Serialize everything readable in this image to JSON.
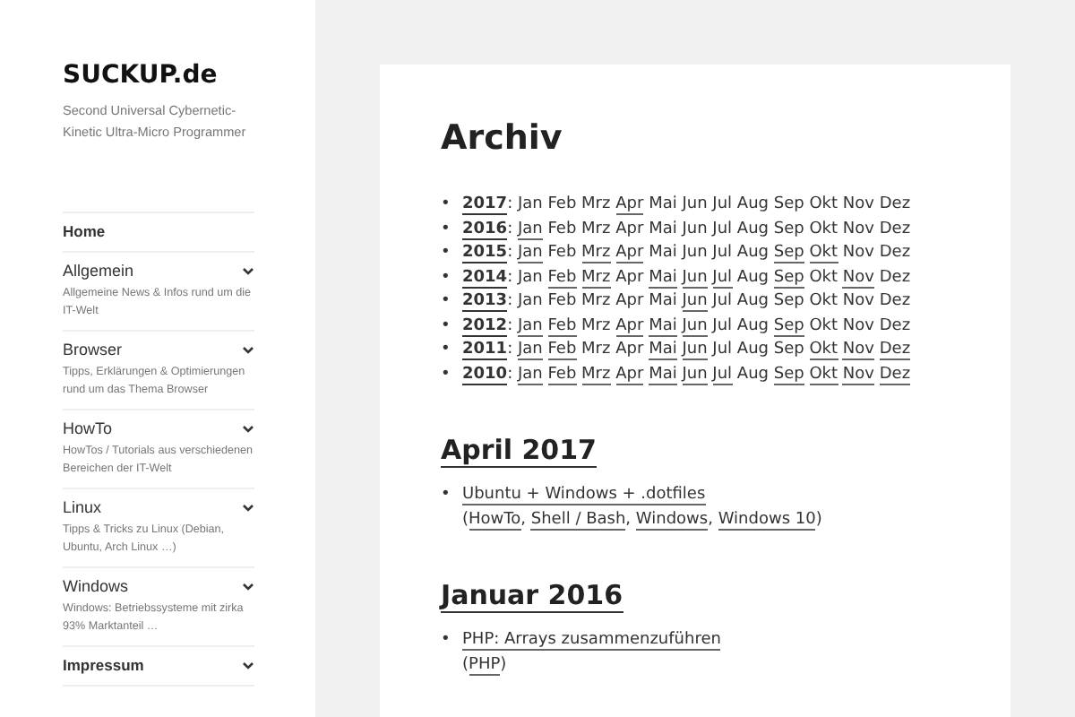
{
  "site": {
    "title": "SUCKUP.de",
    "tagline": "Second Universal Cybernetic-Kinetic Ultra-Micro Programmer"
  },
  "nav": [
    {
      "label": "Home",
      "bold": true,
      "has_submenu": false
    },
    {
      "label": "Allgemein",
      "description": "Allgemeine News & Infos rund um die IT-Welt",
      "bold": false,
      "has_submenu": true
    },
    {
      "label": "Browser",
      "description": "Tipps, Erklärungen & Optimierungen rund um das Thema Browser",
      "bold": false,
      "has_submenu": true
    },
    {
      "label": "HowTo",
      "description": "HowTos / Tutorials aus verschiedenen Bereichen der IT-Welt",
      "bold": false,
      "has_submenu": true
    },
    {
      "label": "Linux",
      "description": "Tipps & Tricks zu Linux (Debian, Ubuntu, Arch Linux …)",
      "bold": false,
      "has_submenu": true
    },
    {
      "label": "Windows",
      "description": "Windows: Betriebssysteme mit zirka 93% Marktanteil …",
      "bold": false,
      "has_submenu": true
    },
    {
      "label": "Impressum",
      "bold": true,
      "has_submenu": true
    }
  ],
  "archive": {
    "title": "Archiv",
    "years": [
      {
        "bullet": "•",
        "year": "2017",
        "separator": ":",
        "months": [
          {
            "label": "Jan",
            "linked": false
          },
          {
            "label": "Feb",
            "linked": false
          },
          {
            "label": "Mrz",
            "linked": false
          },
          {
            "label": "Apr",
            "linked": true
          },
          {
            "label": "Mai",
            "linked": false
          },
          {
            "label": "Jun",
            "linked": false
          },
          {
            "label": "Jul",
            "linked": false
          },
          {
            "label": "Aug",
            "linked": false
          },
          {
            "label": "Sep",
            "linked": false
          },
          {
            "label": "Okt",
            "linked": false
          },
          {
            "label": "Nov",
            "linked": false
          },
          {
            "label": "Dez",
            "linked": false
          }
        ]
      },
      {
        "bullet": "•",
        "year": "2016",
        "separator": ":",
        "months": [
          {
            "label": "Jan",
            "linked": true
          },
          {
            "label": "Feb",
            "linked": false
          },
          {
            "label": "Mrz",
            "linked": false
          },
          {
            "label": "Apr",
            "linked": false
          },
          {
            "label": "Mai",
            "linked": false
          },
          {
            "label": "Jun",
            "linked": false
          },
          {
            "label": "Jul",
            "linked": false
          },
          {
            "label": "Aug",
            "linked": false
          },
          {
            "label": "Sep",
            "linked": false
          },
          {
            "label": "Okt",
            "linked": false
          },
          {
            "label": "Nov",
            "linked": false
          },
          {
            "label": "Dez",
            "linked": false
          }
        ]
      },
      {
        "bullet": "•",
        "year": "2015",
        "separator": ":",
        "months": [
          {
            "label": "Jan",
            "linked": true
          },
          {
            "label": "Feb",
            "linked": false
          },
          {
            "label": "Mrz",
            "linked": true
          },
          {
            "label": "Apr",
            "linked": true
          },
          {
            "label": "Mai",
            "linked": false
          },
          {
            "label": "Jun",
            "linked": false
          },
          {
            "label": "Jul",
            "linked": false
          },
          {
            "label": "Aug",
            "linked": false
          },
          {
            "label": "Sep",
            "linked": true
          },
          {
            "label": "Okt",
            "linked": true
          },
          {
            "label": "Nov",
            "linked": false
          },
          {
            "label": "Dez",
            "linked": false
          }
        ]
      },
      {
        "bullet": "•",
        "year": "2014",
        "separator": ":",
        "months": [
          {
            "label": "Jan",
            "linked": false
          },
          {
            "label": "Feb",
            "linked": true
          },
          {
            "label": "Mrz",
            "linked": true
          },
          {
            "label": "Apr",
            "linked": false
          },
          {
            "label": "Mai",
            "linked": true
          },
          {
            "label": "Jun",
            "linked": true
          },
          {
            "label": "Jul",
            "linked": true
          },
          {
            "label": "Aug",
            "linked": false
          },
          {
            "label": "Sep",
            "linked": true
          },
          {
            "label": "Okt",
            "linked": false
          },
          {
            "label": "Nov",
            "linked": true
          },
          {
            "label": "Dez",
            "linked": false
          }
        ]
      },
      {
        "bullet": "•",
        "year": "2013",
        "separator": ":",
        "months": [
          {
            "label": "Jan",
            "linked": false
          },
          {
            "label": "Feb",
            "linked": false
          },
          {
            "label": "Mrz",
            "linked": false
          },
          {
            "label": "Apr",
            "linked": false
          },
          {
            "label": "Mai",
            "linked": false
          },
          {
            "label": "Jun",
            "linked": true
          },
          {
            "label": "Jul",
            "linked": false
          },
          {
            "label": "Aug",
            "linked": false
          },
          {
            "label": "Sep",
            "linked": false
          },
          {
            "label": "Okt",
            "linked": false
          },
          {
            "label": "Nov",
            "linked": false
          },
          {
            "label": "Dez",
            "linked": false
          }
        ]
      },
      {
        "bullet": "•",
        "year": "2012",
        "separator": ":",
        "months": [
          {
            "label": "Jan",
            "linked": true
          },
          {
            "label": "Feb",
            "linked": true
          },
          {
            "label": "Mrz",
            "linked": false
          },
          {
            "label": "Apr",
            "linked": true
          },
          {
            "label": "Mai",
            "linked": true
          },
          {
            "label": "Jun",
            "linked": true
          },
          {
            "label": "Jul",
            "linked": false
          },
          {
            "label": "Aug",
            "linked": false
          },
          {
            "label": "Sep",
            "linked": true
          },
          {
            "label": "Okt",
            "linked": false
          },
          {
            "label": "Nov",
            "linked": false
          },
          {
            "label": "Dez",
            "linked": false
          }
        ]
      },
      {
        "bullet": "•",
        "year": "2011",
        "separator": ":",
        "months": [
          {
            "label": "Jan",
            "linked": true
          },
          {
            "label": "Feb",
            "linked": true
          },
          {
            "label": "Mrz",
            "linked": false
          },
          {
            "label": "Apr",
            "linked": false
          },
          {
            "label": "Mai",
            "linked": true
          },
          {
            "label": "Jun",
            "linked": true
          },
          {
            "label": "Jul",
            "linked": false
          },
          {
            "label": "Aug",
            "linked": false
          },
          {
            "label": "Sep",
            "linked": false
          },
          {
            "label": "Okt",
            "linked": true
          },
          {
            "label": "Nov",
            "linked": true
          },
          {
            "label": "Dez",
            "linked": true
          }
        ]
      },
      {
        "bullet": "•",
        "year": "2010",
        "separator": ":",
        "months": [
          {
            "label": "Jan",
            "linked": true
          },
          {
            "label": "Feb",
            "linked": true
          },
          {
            "label": "Mrz",
            "linked": true
          },
          {
            "label": "Apr",
            "linked": true
          },
          {
            "label": "Mai",
            "linked": true
          },
          {
            "label": "Jun",
            "linked": true
          },
          {
            "label": "Jul",
            "linked": true
          },
          {
            "label": "Aug",
            "linked": false
          },
          {
            "label": "Sep",
            "linked": true
          },
          {
            "label": "Okt",
            "linked": true
          },
          {
            "label": "Nov",
            "linked": true
          },
          {
            "label": "Dez",
            "linked": true
          }
        ]
      }
    ]
  },
  "sections": [
    {
      "heading": "April 2017",
      "posts": [
        {
          "bullet": "•",
          "title": "Ubuntu + Windows + .dotfiles",
          "open": "(",
          "tags": [
            {
              "label": "HowTo",
              "separator": ","
            },
            {
              "label": "Shell / Bash",
              "separator": ","
            },
            {
              "label": "Windows",
              "separator": ","
            },
            {
              "label": "Windows 10"
            }
          ],
          "close": ")"
        }
      ]
    },
    {
      "heading": "Januar 2016",
      "posts": [
        {
          "bullet": "•",
          "title": "PHP: Arrays zusammenzuführen",
          "open": "(",
          "tags": [
            {
              "label": "PHP"
            }
          ],
          "close": ")"
        }
      ]
    }
  ]
}
